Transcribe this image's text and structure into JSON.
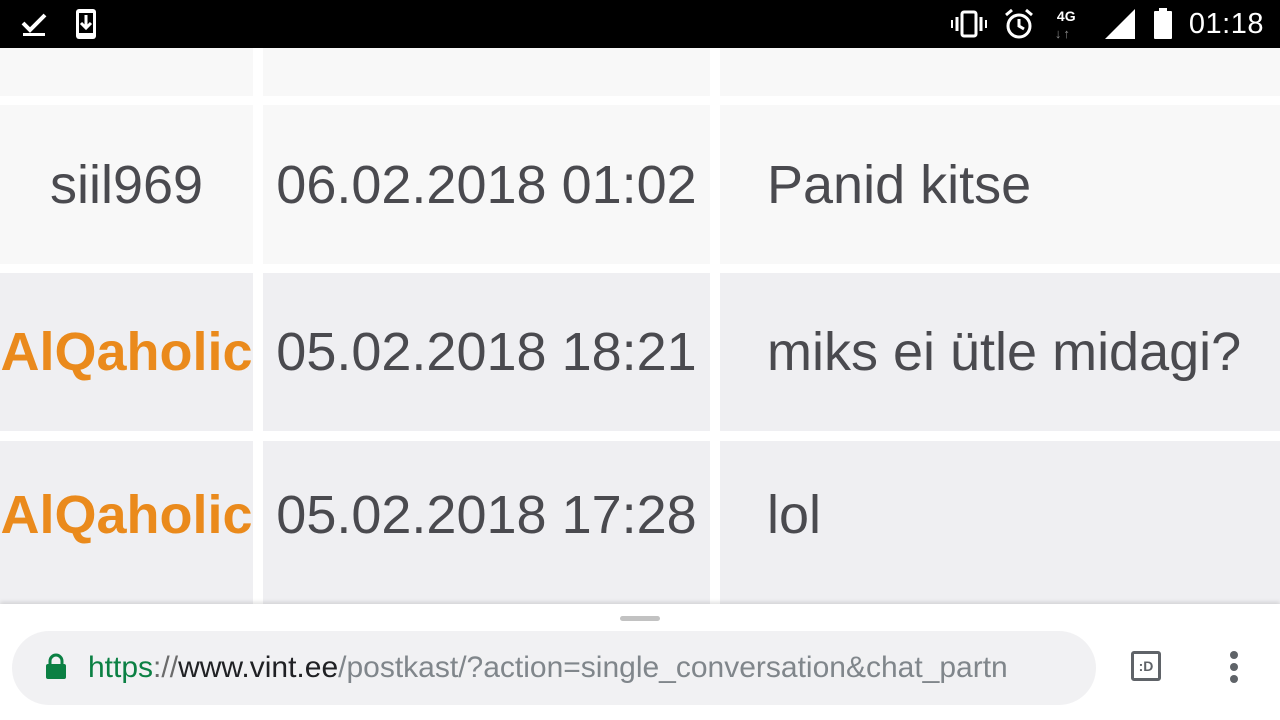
{
  "status_bar": {
    "time": "01:18",
    "network_type": "4G",
    "icons": {
      "left": [
        "check-icon",
        "download-icon"
      ],
      "right": [
        "vibrate-icon",
        "alarm-icon",
        "network-4g-icon",
        "signal-icon",
        "battery-icon"
      ]
    }
  },
  "messages": {
    "rows": [
      {
        "user": "",
        "date": "",
        "text": "",
        "is_self": true
      },
      {
        "user": "siil969",
        "date": "06.02.2018 01:02",
        "text": "Panid kitse",
        "is_self": true
      },
      {
        "user": "AlQaholic",
        "date": "05.02.2018 18:21",
        "text": "miks ei ütle midagi?",
        "is_self": false
      },
      {
        "user": "AlQaholic",
        "date": "05.02.2018 17:28",
        "text": "lol",
        "is_self": false
      }
    ],
    "colors": {
      "other_user": "#ea8a1c",
      "self_user": "#4a4a4f",
      "row_light": "#f8f8f8",
      "row_dark": "#efeff2"
    }
  },
  "browser": {
    "url_scheme": "https",
    "url_separator": "://",
    "url_host": "www.vint.ee",
    "url_path": "/postkast/?action=single_conversation&chat_partn",
    "tab_switcher_label": ":D",
    "icons": [
      "lock-icon",
      "tab-switcher-icon",
      "more-vert-icon"
    ],
    "secure_color": "#0b8043"
  }
}
